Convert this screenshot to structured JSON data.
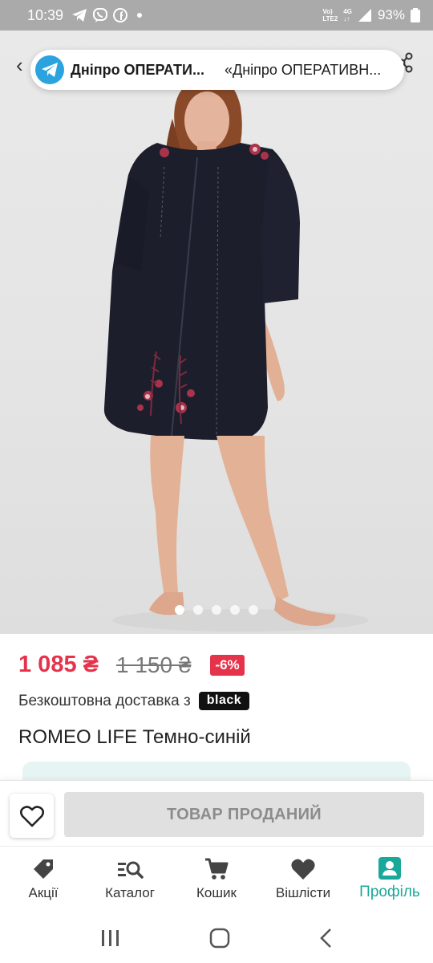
{
  "status_bar": {
    "time": "10:39",
    "network_top": "Vo)",
    "network_bottom": "LTE2",
    "network_type": "4G",
    "battery": "93%"
  },
  "notification": {
    "app_icon": "telegram-icon",
    "title": "Дніпро ОПЕРАТИ...",
    "text": "«Дніпро ОПЕРАТИВН..."
  },
  "gallery": {
    "image_count": 5,
    "active_index": 0
  },
  "product": {
    "price_current": "1 085 ₴",
    "price_old": "1 150 ₴",
    "discount": "-6%",
    "delivery_text": "Безкоштовна доставка з",
    "delivery_badge": "black",
    "title": "ROMEO LIFE Темно-синій"
  },
  "actions": {
    "favorite_icon": "heart-icon",
    "sold_label": "ТОВАР ПРОДАНИЙ"
  },
  "bottom_nav": {
    "items": [
      {
        "label": "Акції",
        "icon": "tag-icon"
      },
      {
        "label": "Каталог",
        "icon": "catalog-search-icon"
      },
      {
        "label": "Кошик",
        "icon": "cart-icon"
      },
      {
        "label": "Вішлісти",
        "icon": "heart-icon"
      },
      {
        "label": "Профіль",
        "icon": "profile-icon"
      }
    ],
    "active_index": 4
  },
  "colors": {
    "accent_price": "#e5334c",
    "accent_active": "#1aa89a",
    "telegram": "#2aa3df"
  }
}
